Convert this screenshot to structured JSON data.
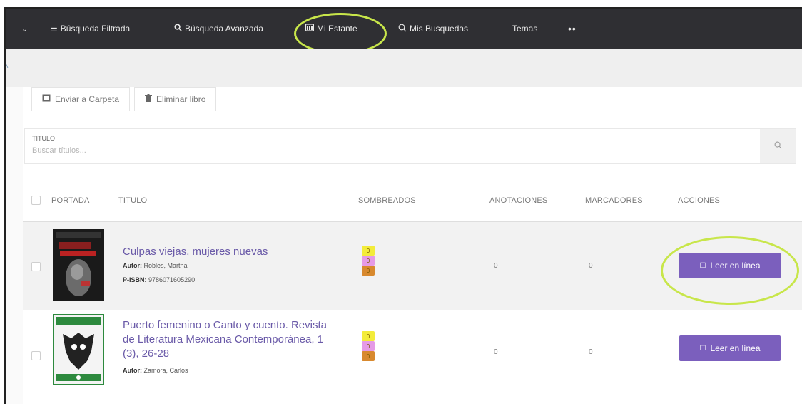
{
  "nav": {
    "items": [
      {
        "label": "Búsqueda Filtrada",
        "icon": "sliders-icon"
      },
      {
        "label": "Búsqueda Avanzada",
        "icon": "search-icon"
      },
      {
        "label": "Mi Estante",
        "icon": "shelf-icon"
      },
      {
        "label": "Mis Busquedas",
        "icon": "search-icon"
      },
      {
        "label": "Temas"
      },
      {
        "label": "••"
      }
    ]
  },
  "toolbar": {
    "send_folder": "Enviar a Carpeta",
    "delete_book": "Eliminar libro"
  },
  "search": {
    "label": "TITULO",
    "placeholder": "Buscar títulos..."
  },
  "table": {
    "headers": {
      "portada": "PORTADA",
      "titulo": "TITULO",
      "sombreados": "SOMBREADOS",
      "anotaciones": "ANOTACIONES",
      "marcadores": "MARCADORES",
      "acciones": "ACCIONES"
    },
    "rows": [
      {
        "title": "Culpas viejas, mujeres nuevas",
        "author_label": "Autor:",
        "author": "Robles, Martha",
        "isbn_label": "P-ISBN:",
        "isbn": "9786071605290",
        "highlights": [
          "0",
          "0",
          "0"
        ],
        "annotations": "0",
        "bookmarks": "0",
        "action": "Leer en línea"
      },
      {
        "title": "Puerto femenino o Canto y cuento. Revista de Literatura Mexicana Contemporánea, 1 (3), 26-28",
        "author_label": "Autor:",
        "author": "Zamora, Carlos",
        "highlights": [
          "0",
          "0",
          "0"
        ],
        "annotations": "0",
        "bookmarks": "0",
        "action": "Leer en línea"
      }
    ]
  },
  "colors": {
    "nav_bg": "#2f2f33",
    "accent_purple": "#7b5fbd",
    "highlight_ring": "#c8e64a",
    "swatch_yellow": "#f3ec3a",
    "swatch_pink": "#e59ae6",
    "swatch_orange": "#d8892e"
  }
}
